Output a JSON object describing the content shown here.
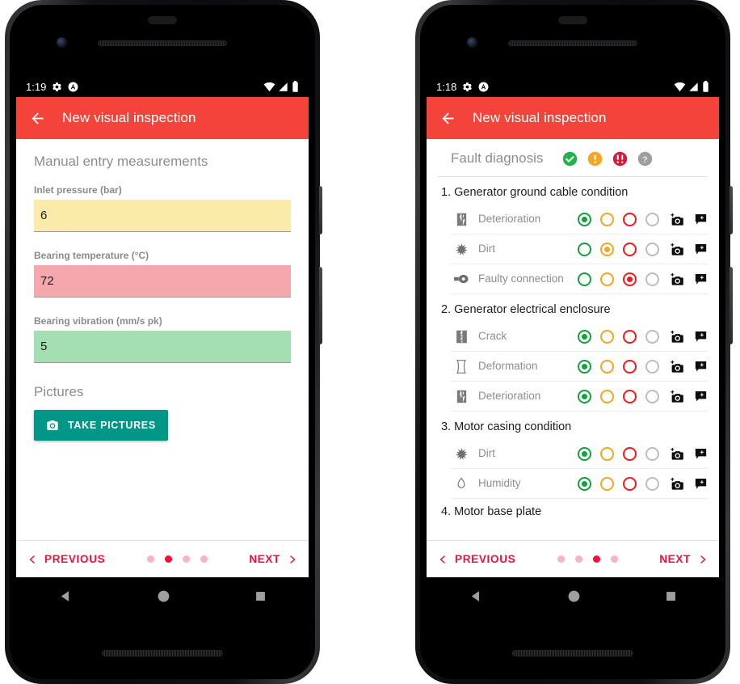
{
  "phones": [
    {
      "id": "left",
      "status_bar": {
        "time": "1:19",
        "icons": [
          "gear-icon",
          "avatar-icon",
          "wifi-icon",
          "signal-icon",
          "battery-icon"
        ]
      },
      "appbar": {
        "back_icon": "back-arrow-icon",
        "title": "New visual inspection"
      },
      "page": {
        "section_title": "Manual entry measurements",
        "fields": [
          {
            "label": "Inlet pressure (bar)",
            "value": "6",
            "status_color": "#FAEBA8"
          },
          {
            "label": "Bearing temperature (°C)",
            "value": "72",
            "status_color": "#F4A8AE"
          },
          {
            "label": "Bearing vibration (mm/s pk)",
            "value": "5",
            "status_color": "#A3DFB0"
          }
        ],
        "pictures_title": "Pictures",
        "take_pictures_label": "TAKE PICTURES"
      },
      "pager": {
        "previous_label": "PREVIOUS",
        "next_label": "NEXT",
        "dot_count": 4,
        "active_dot": 2
      }
    },
    {
      "id": "right",
      "status_bar": {
        "time": "1:18",
        "icons": [
          "gear-icon",
          "avatar-icon",
          "wifi-icon",
          "signal-icon",
          "battery-icon"
        ]
      },
      "appbar": {
        "back_icon": "back-arrow-icon",
        "title": "New visual inspection"
      },
      "page": {
        "header_label": "Fault diagnosis",
        "legend": [
          {
            "name": "status-ok-icon",
            "glyph": "✓",
            "color": "#21B24B"
          },
          {
            "name": "status-warning-icon",
            "glyph": "!",
            "color": "#F5A623"
          },
          {
            "name": "status-critical-icon",
            "glyph": "!!",
            "color": "#D81B3C"
          },
          {
            "name": "status-unknown-icon",
            "glyph": "?",
            "color": "#9E9E9E"
          }
        ],
        "groups": [
          {
            "title": "1. Generator ground cable condition",
            "rows": [
              {
                "icon": "deterioration-icon",
                "label": "Deterioration",
                "selected": 0
              },
              {
                "icon": "dirt-icon",
                "label": "Dirt",
                "selected": 1
              },
              {
                "icon": "faulty-connection-icon",
                "label": "Faulty connection",
                "selected": 2
              }
            ]
          },
          {
            "title": "2. Generator electrical enclosure",
            "rows": [
              {
                "icon": "crack-icon",
                "label": "Crack",
                "selected": 0
              },
              {
                "icon": "deformation-icon",
                "label": "Deformation",
                "selected": 0
              },
              {
                "icon": "deterioration-icon",
                "label": "Deterioration",
                "selected": 0
              }
            ]
          },
          {
            "title": "3. Motor casing condition",
            "rows": [
              {
                "icon": "dirt-icon",
                "label": "Dirt",
                "selected": 0
              },
              {
                "icon": "humidity-icon",
                "label": "Humidity",
                "selected": 0
              }
            ]
          }
        ],
        "next_group_partial": "4. Motor base plate",
        "row_actions": [
          {
            "name": "add-photo-icon"
          },
          {
            "name": "add-note-icon"
          }
        ]
      },
      "pager": {
        "previous_label": "PREVIOUS",
        "next_label": "NEXT",
        "dot_count": 4,
        "active_dot": 3
      }
    }
  ],
  "navbar": {
    "back": "nav-back-icon",
    "home": "nav-home-icon",
    "recents": "nav-recents-icon"
  },
  "colors": {
    "appbar_red": "#F4433A",
    "accent_pink": "#F50E3C",
    "teal": "#009688"
  }
}
